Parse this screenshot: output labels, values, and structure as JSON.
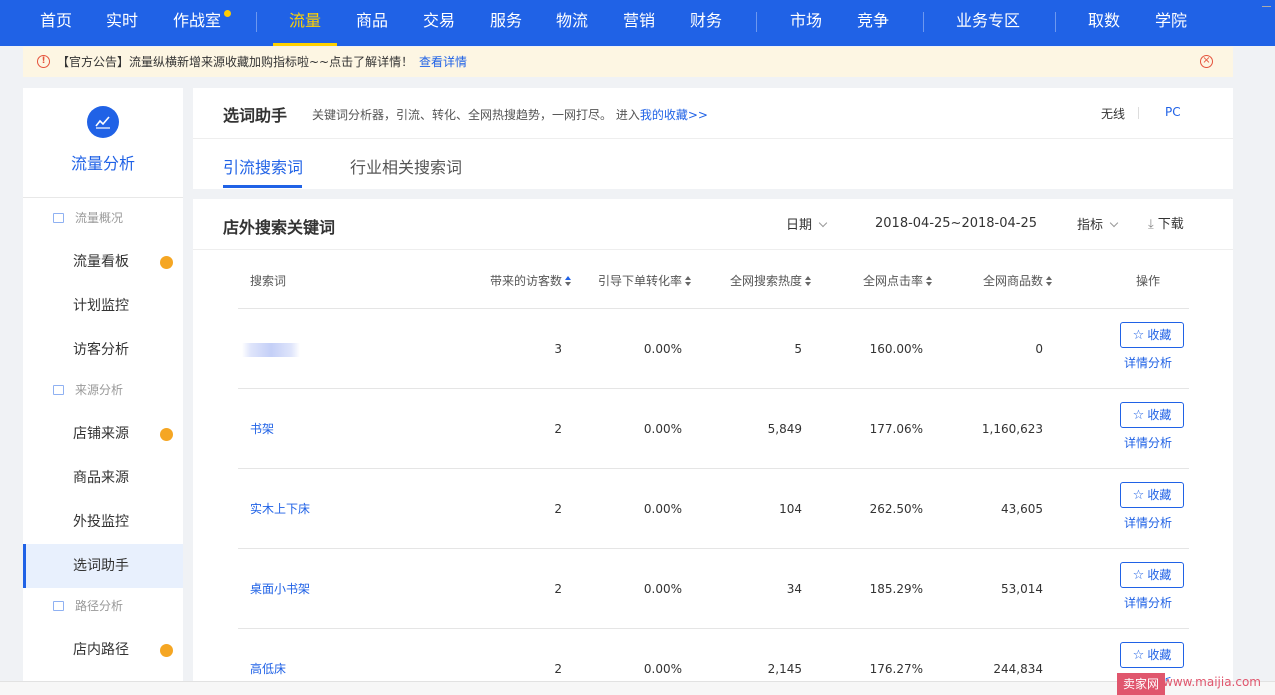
{
  "topnav": {
    "items": [
      "首页",
      "实时",
      "作战室",
      "流量",
      "商品",
      "交易",
      "服务",
      "物流",
      "营销",
      "财务",
      "市场",
      "竞争",
      "业务专区",
      "取数",
      "学院"
    ],
    "active_index": 3
  },
  "notice": {
    "text": "【官方公告】流量纵横新增来源收藏加购指标啦~~点击了解详情！",
    "link": "查看详情"
  },
  "sidebar": {
    "title": "流量分析",
    "groups": [
      "流量概况",
      "来源分析",
      "路径分析"
    ],
    "items": [
      "流量看板",
      "计划监控",
      "访客分析",
      "店铺来源",
      "商品来源",
      "外投监控",
      "选词助手",
      "店内路径"
    ],
    "active_item": "选词助手"
  },
  "header": {
    "title": "选词助手",
    "desc_prefix": "关键词分析器，引流、转化、全网热搜趋势，一网打尽。 进入",
    "desc_link": "我的收藏>>",
    "device_wireless": "无线",
    "device_pc": "PC"
  },
  "tabs": [
    "引流搜索词",
    "行业相关搜索词"
  ],
  "table_panel": {
    "title": "店外搜索关键词",
    "date_label": "日期",
    "date_range": "2018-04-25~2018-04-25",
    "metric_label": "指标",
    "download_label": "下载"
  },
  "table": {
    "columns": [
      "搜索词",
      "带来的访客数",
      "引导下单转化率",
      "全网搜索热度",
      "全网点击率",
      "全网商品数",
      "操作"
    ],
    "fav_label": "收藏",
    "detail_label": "详情分析",
    "rows": [
      {
        "keyword": "",
        "visitors": "3",
        "conv": "0.00%",
        "heat": "5",
        "ctr": "160.00%",
        "items": "0"
      },
      {
        "keyword": "书架",
        "visitors": "2",
        "conv": "0.00%",
        "heat": "5,849",
        "ctr": "177.06%",
        "items": "1,160,623"
      },
      {
        "keyword": "实木上下床",
        "visitors": "2",
        "conv": "0.00%",
        "heat": "104",
        "ctr": "262.50%",
        "items": "43,605"
      },
      {
        "keyword": "桌面小书架",
        "visitors": "2",
        "conv": "0.00%",
        "heat": "34",
        "ctr": "185.29%",
        "items": "53,014"
      },
      {
        "keyword": "高低床",
        "visitors": "2",
        "conv": "0.00%",
        "heat": "2,145",
        "ctr": "176.27%",
        "items": "244,834"
      }
    ]
  },
  "watermark": {
    "badge": "卖家网",
    "url": "www.maijia.com"
  },
  "colors": {
    "brand": "#2062e6",
    "active_nav": "#ffd200",
    "dot": "#f5a623"
  }
}
